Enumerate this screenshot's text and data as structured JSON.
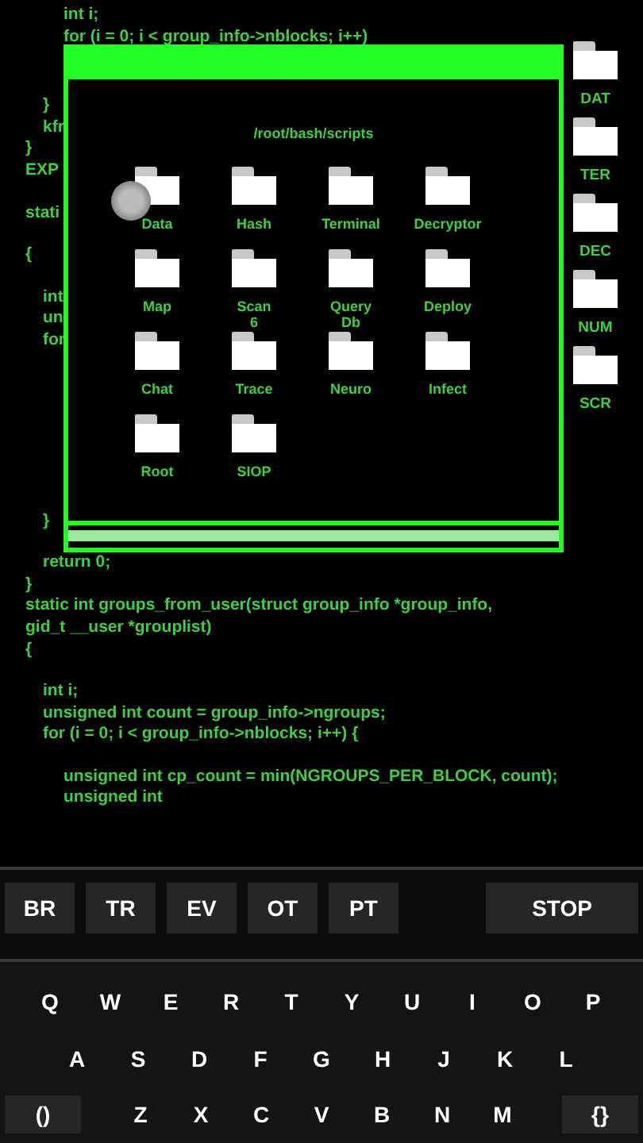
{
  "code_lines": [
    "int i;",
    "for (i = 0; i < group_info->nblocks; i++)",
    "}",
    "kfr",
    "}",
    "EXP",
    "stati",
    "{",
    "int",
    "un",
    "for",
    "}",
    "return 0;",
    "}",
    "static int groups_from_user(struct group_info *group_info,",
    "gid_t __user *grouplist)",
    "{",
    "int i;",
    "unsigned int count = group_info->ngroups;",
    "for (i = 0; i < group_info->nblocks; i++) {",
    "unsigned int cp_count = min(NGROUPS_PER_BLOCK, count);",
    "unsigned int"
  ],
  "window": {
    "path": "/root/bash/scripts",
    "folders": [
      {
        "label": "Data"
      },
      {
        "label": "Hash"
      },
      {
        "label": "Terminal"
      },
      {
        "label": "Decryptor"
      },
      {
        "label": "Map"
      },
      {
        "label": "Scan\n6"
      },
      {
        "label": "Query\nDb"
      },
      {
        "label": "Deploy"
      },
      {
        "label": "Chat"
      },
      {
        "label": "Trace"
      },
      {
        "label": "Neuro"
      },
      {
        "label": "Infect"
      },
      {
        "label": "Root"
      },
      {
        "label": "SIOP"
      }
    ]
  },
  "side_folders": [
    {
      "label": "DAT"
    },
    {
      "label": "TER"
    },
    {
      "label": "DEC"
    },
    {
      "label": "NUM"
    },
    {
      "label": "SCR"
    }
  ],
  "toolbar": {
    "buttons": [
      "BR",
      "TR",
      "EV",
      "OT",
      "PT"
    ],
    "stop": "STOP"
  },
  "keyboard": {
    "rows": [
      [
        "Q",
        "W",
        "E",
        "R",
        "T",
        "Y",
        "U",
        "I",
        "O",
        "P"
      ],
      [
        "A",
        "S",
        "D",
        "F",
        "G",
        "H",
        "J",
        "K",
        "L"
      ],
      [
        "Z",
        "X",
        "C",
        "V",
        "B",
        "N",
        "M"
      ]
    ],
    "left_key": "()",
    "right_key": "{}"
  }
}
